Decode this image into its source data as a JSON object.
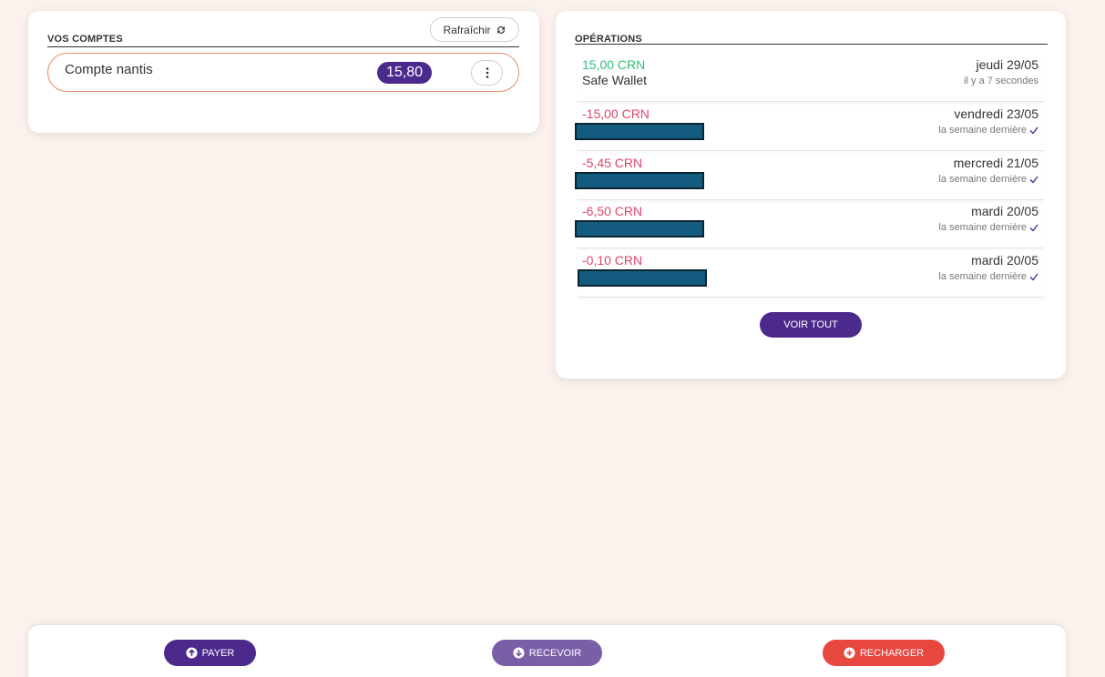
{
  "accounts": {
    "heading": "VOS COMPTES",
    "refresh_label": "Rafraîchir",
    "items": [
      {
        "name": "Compte nantis",
        "balance": "15,80"
      }
    ]
  },
  "operations": {
    "heading": "OPÉRATIONS",
    "items": [
      {
        "amount": "15,00 CRN",
        "label": "Safe Wallet",
        "date": "jeudi 29/05",
        "relative": "il y a 7 secondes",
        "direction": "positive",
        "confirmed": false
      },
      {
        "amount": "-15,00 CRN",
        "label": "",
        "date": "vendredi 23/05",
        "relative": "la semaine dernière",
        "direction": "negative",
        "confirmed": true
      },
      {
        "amount": "-5,45 CRN",
        "label": "",
        "date": "mercredi 21/05",
        "relative": "la semaine dernière",
        "direction": "negative",
        "confirmed": true
      },
      {
        "amount": "-6,50 CRN",
        "label": "",
        "date": "mardi 20/05",
        "relative": "la semaine dernière",
        "direction": "negative",
        "confirmed": true
      },
      {
        "amount": "-0,10 CRN",
        "label": "",
        "date": "mardi 20/05",
        "relative": "la semaine dernière",
        "direction": "negative",
        "confirmed": true
      }
    ],
    "view_all_label": "VOIR TOUT"
  },
  "actions": {
    "pay_label": "PAYER",
    "receive_label": "RECEVOIR",
    "recharge_label": "RECHARGER"
  },
  "colors": {
    "primary": "#4b2a8c",
    "secondary": "#7a5ea8",
    "accent": "#e8473f",
    "positive": "#2fbf7a",
    "negative": "#e0456a",
    "background": "#fbf2ed"
  },
  "icons": {
    "refresh": "refresh-icon",
    "account_menu": "more-vertical-icon",
    "confirmed": "check-icon",
    "pay": "arrow-up-circle-icon",
    "receive": "arrow-down-circle-icon",
    "recharge": "plus-circle-icon"
  }
}
